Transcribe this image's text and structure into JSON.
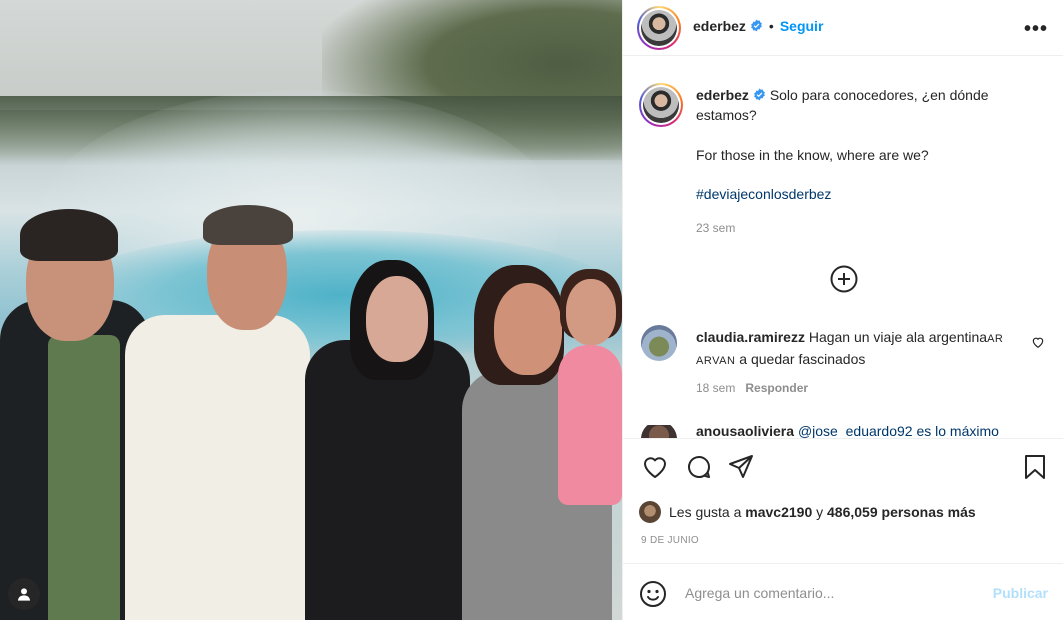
{
  "post": {
    "username": "ederbez",
    "follow_label": "Seguir",
    "separator": "•",
    "more_label": "•••"
  },
  "caption": {
    "username": "ederbez",
    "text_es": "Solo para conocedores, ¿en dónde estamos?",
    "text_en": "For those in the know, where are we?",
    "hashtag": "#deviajeconlosderbez",
    "time": "23 sem"
  },
  "comments": [
    {
      "username": "claudia.ramirezz",
      "text_lead": "Hagan un viaje ala argentina",
      "text_caps": "AR ARVAN",
      "text_tail": "a quedar fascinados",
      "time": "18 sem",
      "reply_label": "Responder"
    },
    {
      "username": "anousaoliviera",
      "text": "@jose_eduardo92 es lo máximo"
    }
  ],
  "likes": {
    "prefix": "Les gusta a",
    "user": "mavc2190",
    "mid": "y",
    "count": "486,059 personas más"
  },
  "date": "9 DE JUNIO",
  "add_comment": {
    "placeholder": "Agrega un comentario...",
    "publish_label": "Publicar"
  },
  "colors": {
    "accent": "#0095f6",
    "hashtag": "#00376b",
    "muted": "#8e8e8e",
    "publish_disabled": "#b2dffc"
  },
  "icons": [
    "verified-icon",
    "more-options-icon",
    "add-circle-icon",
    "heart-icon",
    "comment-icon",
    "share-icon",
    "bookmark-icon",
    "emoji-icon",
    "user-tag-icon"
  ]
}
